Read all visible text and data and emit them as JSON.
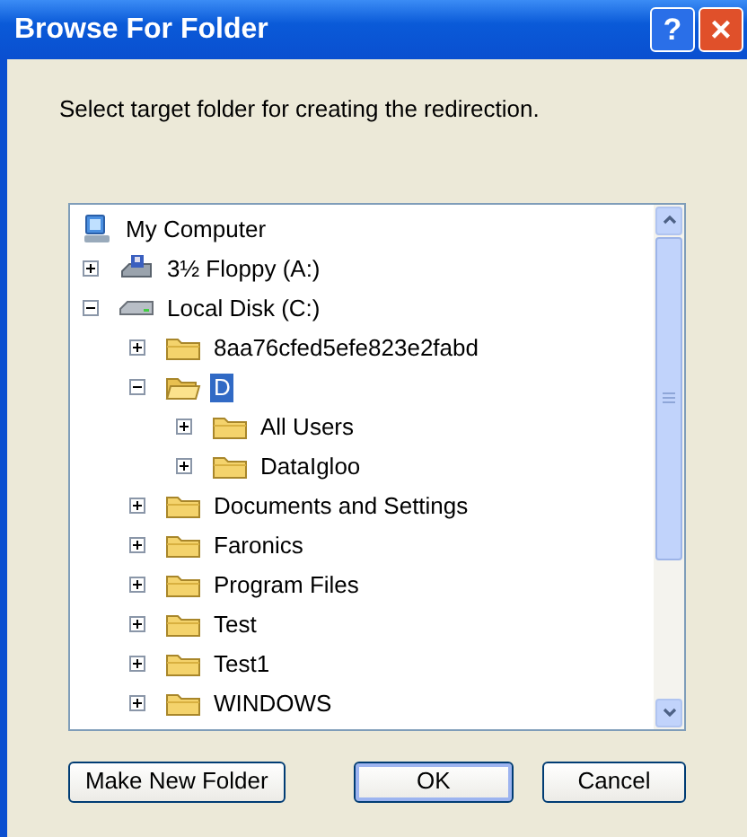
{
  "window": {
    "title": "Browse For Folder",
    "help_button": "?",
    "close_button": "×"
  },
  "prompt": "Select target folder for creating the redirection.",
  "tree": [
    {
      "label": "My Computer",
      "kind": "computer",
      "selected": false,
      "children": [
        {
          "label": "3½ Floppy (A:)",
          "kind": "floppy",
          "expanded": false,
          "selected": false
        },
        {
          "label": "Local Disk (C:)",
          "kind": "disk",
          "expanded": true,
          "selected": false,
          "children": [
            {
              "label": "8aa76cfed5efe823e2fabd",
              "kind": "folder",
              "expanded": false,
              "selected": false
            },
            {
              "label": "D",
              "kind": "folder",
              "expanded": true,
              "selected": true,
              "children": [
                {
                  "label": "All Users",
                  "kind": "folder",
                  "expanded": false,
                  "selected": false
                },
                {
                  "label": "DataIgloo",
                  "kind": "folder",
                  "expanded": false,
                  "selected": false
                }
              ]
            },
            {
              "label": "Documents and Settings",
              "kind": "folder",
              "expanded": false,
              "selected": false
            },
            {
              "label": "Faronics",
              "kind": "folder",
              "expanded": false,
              "selected": false
            },
            {
              "label": "Program Files",
              "kind": "folder",
              "expanded": false,
              "selected": false
            },
            {
              "label": "Test",
              "kind": "folder",
              "expanded": false,
              "selected": false
            },
            {
              "label": "Test1",
              "kind": "folder",
              "expanded": false,
              "selected": false
            },
            {
              "label": "WINDOWS",
              "kind": "folder",
              "expanded": false,
              "selected": false
            }
          ]
        }
      ]
    }
  ],
  "buttons": [
    {
      "label": "Make New Folder",
      "kind": "action"
    },
    {
      "label": "OK",
      "kind": "default"
    },
    {
      "label": "Cancel",
      "kind": "action"
    }
  ]
}
